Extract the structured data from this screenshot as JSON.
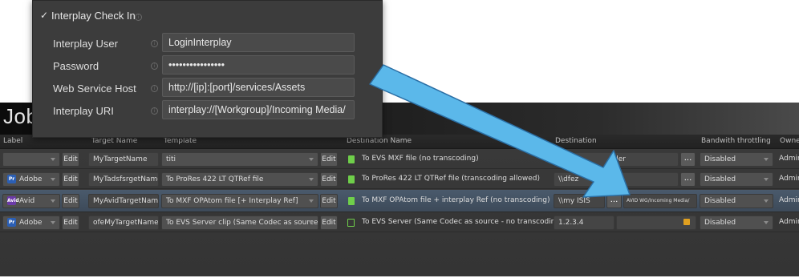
{
  "interplay_panel": {
    "title": "Interplay Check In",
    "fields": [
      {
        "label": "Interplay User",
        "value": "LoginInterplay"
      },
      {
        "label": "Password",
        "value": "••••••••••••••••"
      },
      {
        "label": "Web Service Host",
        "value": "http://[ip]:[port]/services/Assets"
      },
      {
        "label": "Interplay URI",
        "value": "interplay://[Workgroup]/Incoming Media/"
      }
    ]
  },
  "job_grid": {
    "title": "Job",
    "columns": [
      "Label",
      "Target Name",
      "Template",
      "Destination Name",
      "Destination",
      "Bandwith throttling",
      "Owne"
    ],
    "edit_label": "Edit",
    "dots_label": "...",
    "rows": [
      {
        "label": "",
        "app": "",
        "target_name": "MyTargetName",
        "template": "titi",
        "destination_name": "To EVS MXF file (no transcoding)",
        "destination": "der",
        "destination_extra": "",
        "throttling": "Disabled",
        "owner": "Admin"
      },
      {
        "label": "Adobe",
        "app": "Pr",
        "target_name": "MyTadsfsrgetName",
        "template": "To ProRes 422 LT QTRef file",
        "destination_name": "To ProRes 422 LT QTRef file (transcoding allowed)",
        "destination": "\\\\dfez",
        "destination_extra": "",
        "throttling": "Disabled",
        "owner": "Admin"
      },
      {
        "label": "Avid",
        "app": "Avid",
        "target_name": "MyAvidTargetName",
        "template": "To MXF OPAtom file [+ Interplay Ref]",
        "destination_name": "To MXF OPAtom file + interplay Ref (no transcoding)",
        "destination": "\\\\my ISIS",
        "destination_extra": "AVID WG/Incoming Media/",
        "throttling": "Disabled",
        "owner": "Admin"
      },
      {
        "label": "Adobe",
        "app": "Pr",
        "target_name": "ofeMyTargetName",
        "template": "To EVS Server clip (Same Codec as source)",
        "destination_name": "To EVS Server  (Same Codec as source - no transcoding)",
        "destination": "1.2.3.4",
        "destination_extra": "",
        "throttling": "Disabled",
        "owner": "Admin"
      }
    ]
  },
  "colors": {
    "arrow": "#5bb8ea",
    "selected_row": "#4a5a6c",
    "file_icon": "#6fcf4a"
  }
}
